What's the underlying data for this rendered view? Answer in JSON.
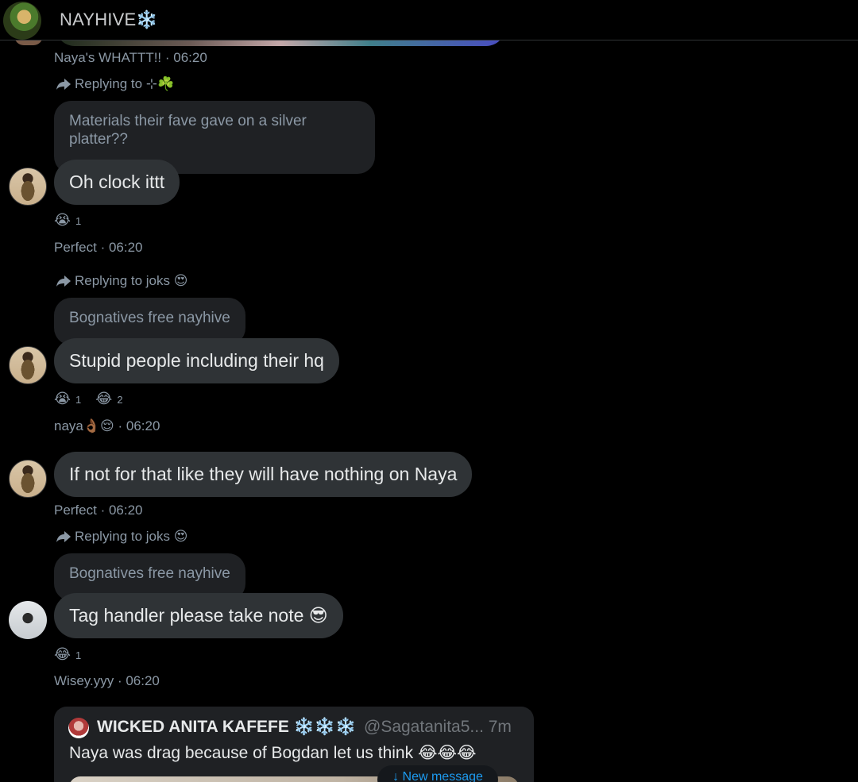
{
  "header": {
    "title": "NAYHIVE❄️"
  },
  "messages": [
    {
      "meta": "Naya's WHATTT!! · 06:20",
      "replying_to": "Replying to ⊹☘️",
      "quote": "Materials their fave gave on a silver platter??",
      "text": "Oh clock ittt",
      "reactions": [
        {
          "emoji": "😭",
          "count": "1"
        }
      ]
    },
    {
      "meta": "Perfect · 06:20",
      "replying_to": "Replying to joks 😍",
      "quote": "Bognatives free nayhive",
      "text": "Stupid people including their hq",
      "reactions": [
        {
          "emoji": "😭",
          "count": "1"
        },
        {
          "emoji": "😂",
          "count": "2"
        }
      ]
    },
    {
      "meta": "naya👌🏾😌 · 06:20",
      "text": "If not for that like they will have nothing on Naya"
    },
    {
      "meta": "Perfect · 06:20",
      "replying_to": "Replying to joks 😍",
      "quote": "Bognatives free nayhive",
      "text": "Tag handler please take note 😎",
      "reactions": [
        {
          "emoji": "😂",
          "count": "1"
        }
      ]
    },
    {
      "meta": "Wisey.yyy · 06:20"
    }
  ],
  "quoted_post": {
    "name": "WICKED ANITA KAFEFE ❄️❄️❄️",
    "handle": "@Sagatanita5... 7m",
    "text": "Naya was drag because of Bogdan let us think 😂😂😂"
  },
  "new_message": "↓ New message"
}
